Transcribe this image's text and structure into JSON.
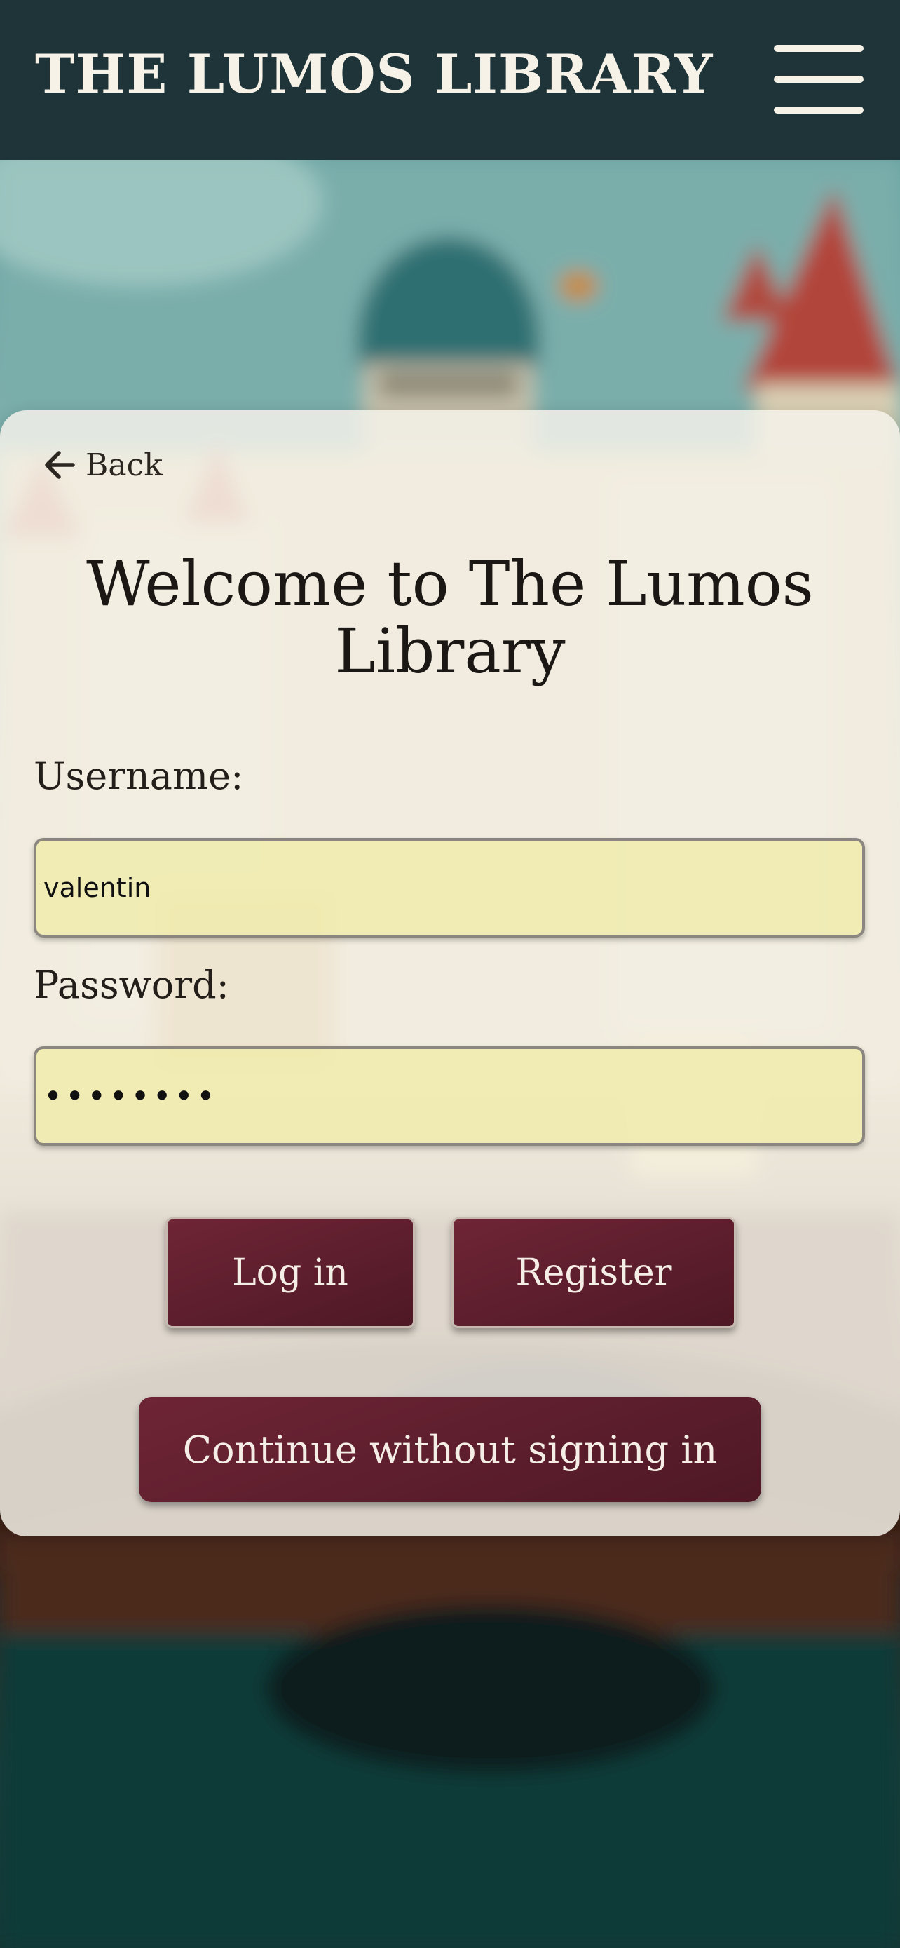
{
  "header": {
    "brand": "THE LUMOS LIBRARY",
    "menu_icon": "hamburger-menu-icon"
  },
  "card": {
    "back_label": "Back",
    "back_icon": "arrow-left-icon",
    "title": "Welcome to The Lumos Library",
    "username": {
      "label": "Username:",
      "value": "valentin"
    },
    "password": {
      "label": "Password:",
      "value": "12345678"
    },
    "buttons": {
      "login": "Log in",
      "register": "Register",
      "guest": "Continue without signing in"
    }
  },
  "colors": {
    "header_bg": "#1f3438",
    "button_bg": "#5b1d2c",
    "input_bg": "#f0eca8",
    "card_bg": "#f6f3eb"
  }
}
